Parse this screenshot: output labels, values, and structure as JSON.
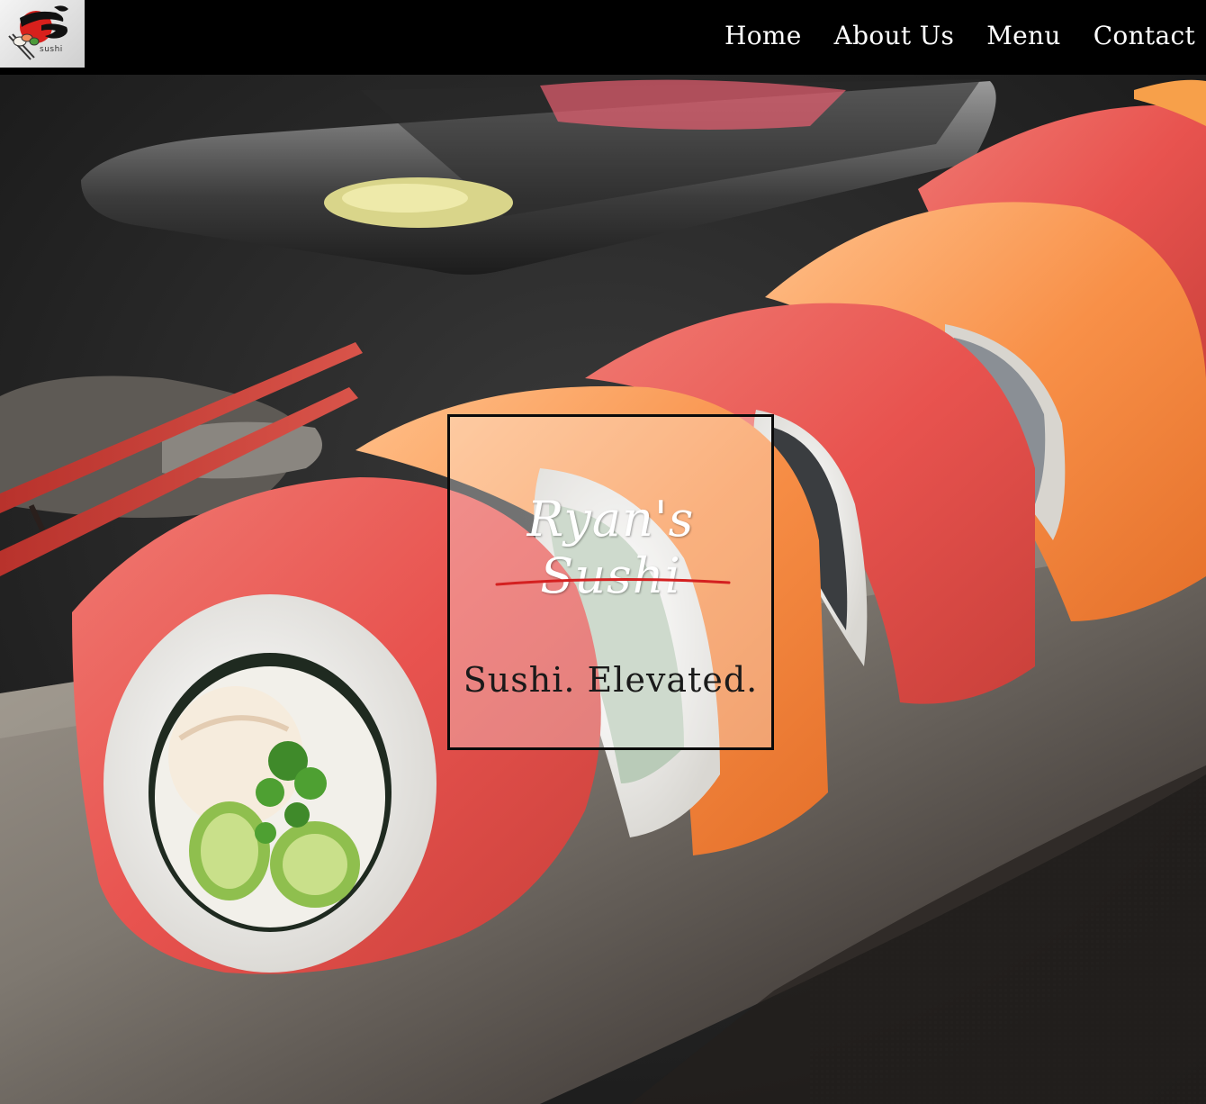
{
  "header": {
    "logo_text": "sushi",
    "nav": [
      {
        "label": "Home"
      },
      {
        "label": "About Us"
      },
      {
        "label": "Menu"
      },
      {
        "label": "Contact"
      }
    ]
  },
  "hero": {
    "brand": "Ryan's Sushi",
    "tagline": "Sushi. Elevated.",
    "image": "sushi-rolls-photo"
  },
  "colors": {
    "navbar": "#000000",
    "accent_red": "#d42020",
    "nav_text": "#ffffff"
  }
}
